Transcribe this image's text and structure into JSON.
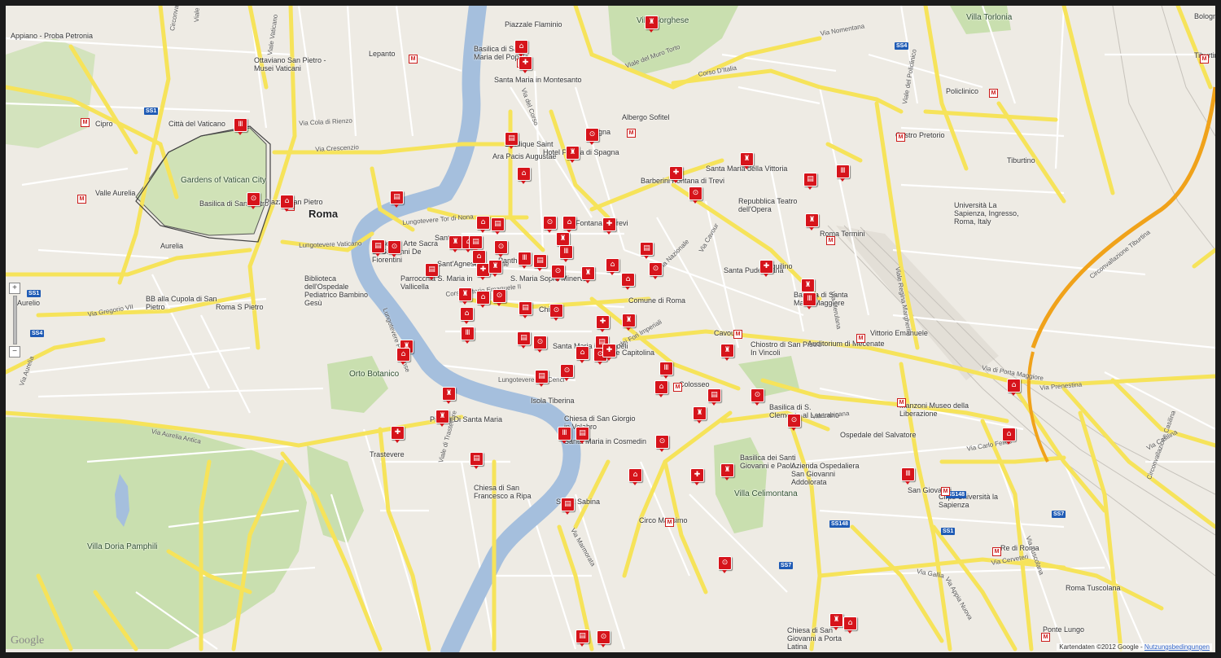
{
  "map": {
    "city_label": "Roma",
    "attribution_prefix": "Kartendaten ©2012 Google -",
    "terms_link": "Nutzungsbedingungen",
    "logo": "Google",
    "zoom_in": "+",
    "zoom_out": "−",
    "colors": {
      "road": "#f6e35a",
      "background": "#eeebe4",
      "park": "#c9dfaf",
      "water": "#a5bfdd",
      "poi": "#d6141b",
      "highway": "#f0a21a"
    }
  },
  "places": [
    {
      "text": "Piazzale Flaminio"
    },
    {
      "text": "Basilica di Santa Maria del Popolo"
    },
    {
      "text": "Santa Maria in Montesanto"
    },
    {
      "text": "Villa Borghese"
    },
    {
      "text": "Villa Torlonia"
    },
    {
      "text": "Città del Vaticano"
    },
    {
      "text": "Gardens of Vatican City"
    },
    {
      "text": "Basilica di San Pietro"
    },
    {
      "text": "Piazza San Pietro"
    },
    {
      "text": "Ottaviano San Pietro - Musei Vaticani"
    },
    {
      "text": "Lepanto"
    },
    {
      "text": "Cipro"
    },
    {
      "text": "Spagna"
    },
    {
      "text": "Ara Pacis Augustae"
    },
    {
      "text": "Hotel Piazza di Spagna"
    },
    {
      "text": "Albergo Sofitel"
    },
    {
      "text": "Barberini Fontana di Trevi"
    },
    {
      "text": "Santa Maria della Vittoria"
    },
    {
      "text": "Repubblica Teatro dell'Opera"
    },
    {
      "text": "Fontana di Trevi"
    },
    {
      "text": "Castro Pretorio"
    },
    {
      "text": "Policlinico"
    },
    {
      "text": "Tiburtino"
    },
    {
      "text": "Università La Sapienza, Ingresso, Roma, Italy"
    },
    {
      "text": "Museo di Arte Sacra S. Giovanni De Fiorentini"
    },
    {
      "text": "Sant'Agnese in Agone"
    },
    {
      "text": "Pantheon"
    },
    {
      "text": "S. Maria Sopra Minerva"
    },
    {
      "text": "Parrocchia S. Maria in Vallicella"
    },
    {
      "text": "Biblioteca dell'Ospedale Pediatrico Bambino Gesù"
    },
    {
      "text": "Roma Termini"
    },
    {
      "text": "Santa Pudenziana"
    },
    {
      "text": "Esquilino"
    },
    {
      "text": "Basilica di Santa Maria Maggiore"
    },
    {
      "text": "Comune di Roma"
    },
    {
      "text": "Cavour"
    },
    {
      "text": "Chiostro di San Pietro In Vincoli"
    },
    {
      "text": "Auditorium di Mecenate"
    },
    {
      "text": "Vittorio Emanuele"
    },
    {
      "text": "Santa Maria in Aracoeli"
    },
    {
      "text": "Rupe Capitolina"
    },
    {
      "text": "Colosseo"
    },
    {
      "text": "Basilica di S. Clemente al Laterano"
    },
    {
      "text": "Manzoni Museo della Liberazione"
    },
    {
      "text": "Orto Botanico"
    },
    {
      "text": "Isola Tiberina"
    },
    {
      "text": "Piazza Di Santa Maria"
    },
    {
      "text": "Trastevere"
    },
    {
      "text": "Chiesa di San Giorgio in Velabro"
    },
    {
      "text": "Santa Maria in Cosmedin"
    },
    {
      "text": "Chiesa di San Francesco a Ripa"
    },
    {
      "text": "Santa Sabina"
    },
    {
      "text": "Circo Massimo"
    },
    {
      "text": "Villa Celimontana"
    },
    {
      "text": "Basilica dei Santi Giovanni e Paolo"
    },
    {
      "text": "Azienda Ospedaliera San Giovanni Addolorata"
    },
    {
      "text": "Ospedale del Salvatore"
    },
    {
      "text": "San Giovanni"
    },
    {
      "text": "Cirps Università la Sapienza"
    },
    {
      "text": "Re di Roma"
    },
    {
      "text": "Roma Tuscolana"
    },
    {
      "text": "Ponte Lungo"
    },
    {
      "text": "Chiesa di San Giovanni a Porta Latina"
    },
    {
      "text": "Villa Doria Pamphili"
    },
    {
      "text": "BB alla Cupola di San Pietro"
    },
    {
      "text": "Roma S Pietro"
    },
    {
      "text": "Aurelio"
    },
    {
      "text": "Appiano - Proba Petronia"
    },
    {
      "text": "Valle Aurelia"
    },
    {
      "text": "Aurelia"
    },
    {
      "text": "Chiesa"
    },
    {
      "text": "Tiburtina"
    },
    {
      "text": "Bologna"
    },
    {
      "text": "Basilique Saint"
    },
    {
      "text": "Santa"
    }
  ],
  "roads": [
    {
      "text": "Viale delle Milizie"
    },
    {
      "text": "Via Cola di Rienzo"
    },
    {
      "text": "Via Crescenzio"
    },
    {
      "text": "Lungotevere Tor di Nona"
    },
    {
      "text": "Lungotevere Vaticano"
    },
    {
      "text": "Corso Vittorio Emanuele II"
    },
    {
      "text": "Lungotevere Dei Cenci"
    },
    {
      "text": "Via dei Fori Imperiali"
    },
    {
      "text": "Via Nazionale"
    },
    {
      "text": "Via Cavour"
    },
    {
      "text": "Via Merulana"
    },
    {
      "text": "Via Labicana"
    },
    {
      "text": "Via Prenestina"
    },
    {
      "text": "Circonvallazione Tiburtina"
    },
    {
      "text": "Via Nomentana"
    },
    {
      "text": "Corso D'Italia"
    },
    {
      "text": "Viale del Muro Torto"
    },
    {
      "text": "Via Aurelia Antica"
    },
    {
      "text": "Viale di Trastevere"
    },
    {
      "text": "Via Marmorata"
    },
    {
      "text": "Via Appia Nuova"
    },
    {
      "text": "Via Tuscolana"
    },
    {
      "text": "Circonvallazione Casilina"
    },
    {
      "text": "Via Gregorio VII"
    },
    {
      "text": "Via Aurelia"
    },
    {
      "text": "Via Casilina"
    },
    {
      "text": "Viale Regina Margherita"
    },
    {
      "text": "Via del Corso"
    },
    {
      "text": "Viale Vaticano"
    },
    {
      "text": "Via di Porta Maggiore"
    },
    {
      "text": "Via Gallia"
    },
    {
      "text": "Via Cerveteri"
    },
    {
      "text": "Lungotevere Portuense"
    },
    {
      "text": "Circonvallazione Trionfale"
    },
    {
      "text": "Viale del Policlinico"
    },
    {
      "text": "Via Carlo Felice"
    }
  ],
  "shields": [
    "SS1",
    "SS4",
    "SS148",
    "SS7"
  ],
  "metro_symbol": "M",
  "poi_icons": [
    "museum",
    "church",
    "monument",
    "theatre",
    "hotel",
    "ruin",
    "viewpoint"
  ]
}
